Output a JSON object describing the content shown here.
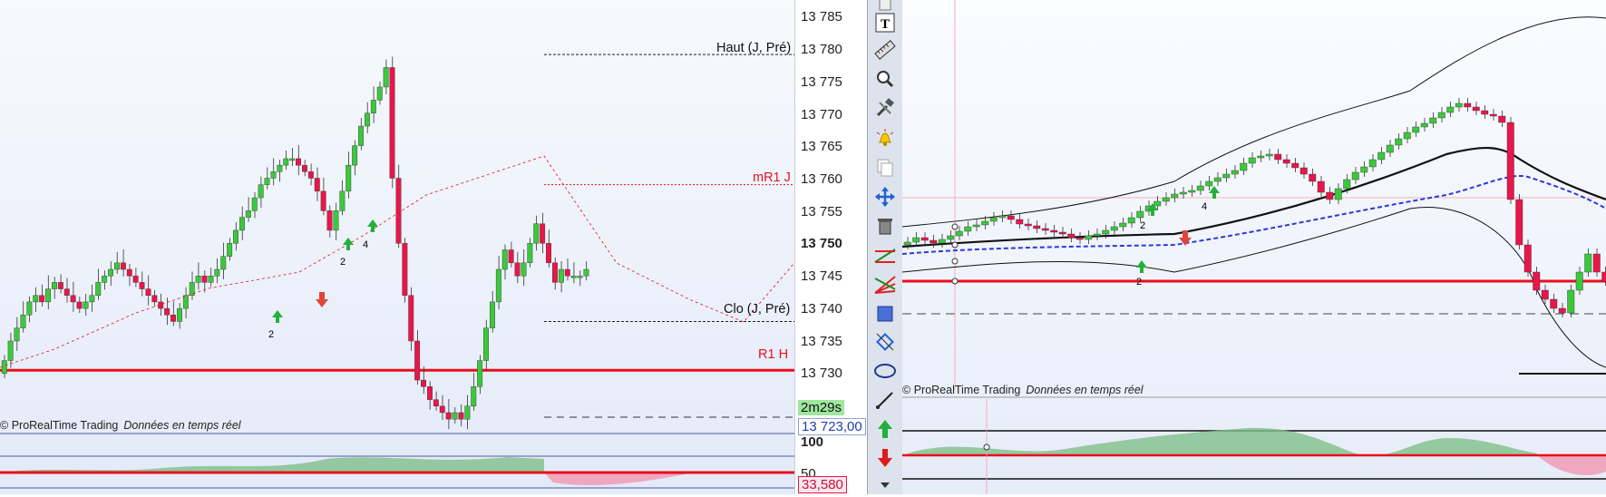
{
  "left_chart": {
    "price_ticks": [
      "13 785",
      "13 780",
      "13 775",
      "13 770",
      "13 765",
      "13 760",
      "13 755",
      "13 750",
      "13 745",
      "13 740",
      "13 735",
      "13 730"
    ],
    "current_tick": "13 750",
    "level_labels": {
      "haut": "Haut (J, Pré)",
      "mr1": "mR1 J",
      "clo": "Clo (J, Pré)",
      "r1h": "R1 H"
    },
    "timer": "2m29s",
    "last_price": "13 723,00",
    "osc_top": "100",
    "osc_mid": "50",
    "osc_value": "33,580",
    "signal_counts": [
      "2",
      "2",
      "4"
    ],
    "watermark_brand": "ProRealTime Trading",
    "watermark_note": "Données en temps réel"
  },
  "right_chart": {
    "signal_counts": [
      "2",
      "2",
      "4"
    ],
    "watermark_brand": "ProRealTime Trading",
    "watermark_note": "Données en temps réel"
  },
  "toolbar": {
    "tools": [
      "cursor-icon",
      "text-icon",
      "ruler-icon",
      "zoom-icon",
      "tools-icon",
      "alarm-icon",
      "copy-icon",
      "move-icon",
      "delete-icon",
      "trendline-icon",
      "fan-icon",
      "rectangle-icon",
      "rotate-rect-icon",
      "ellipse-icon",
      "arrow-line-icon",
      "up-arrow-icon",
      "down-arrow-icon",
      "scroll-down-icon"
    ]
  },
  "colors": {
    "up_candle": "#3cc83c",
    "down_candle": "#e8164a",
    "resistance_line": "#e8101c",
    "osc_fill_up": "#7fbf8a",
    "osc_fill_down": "#f0a0b8",
    "last_price_blue": "#1d3fb0",
    "timer_bg": "#9fe69f"
  }
}
